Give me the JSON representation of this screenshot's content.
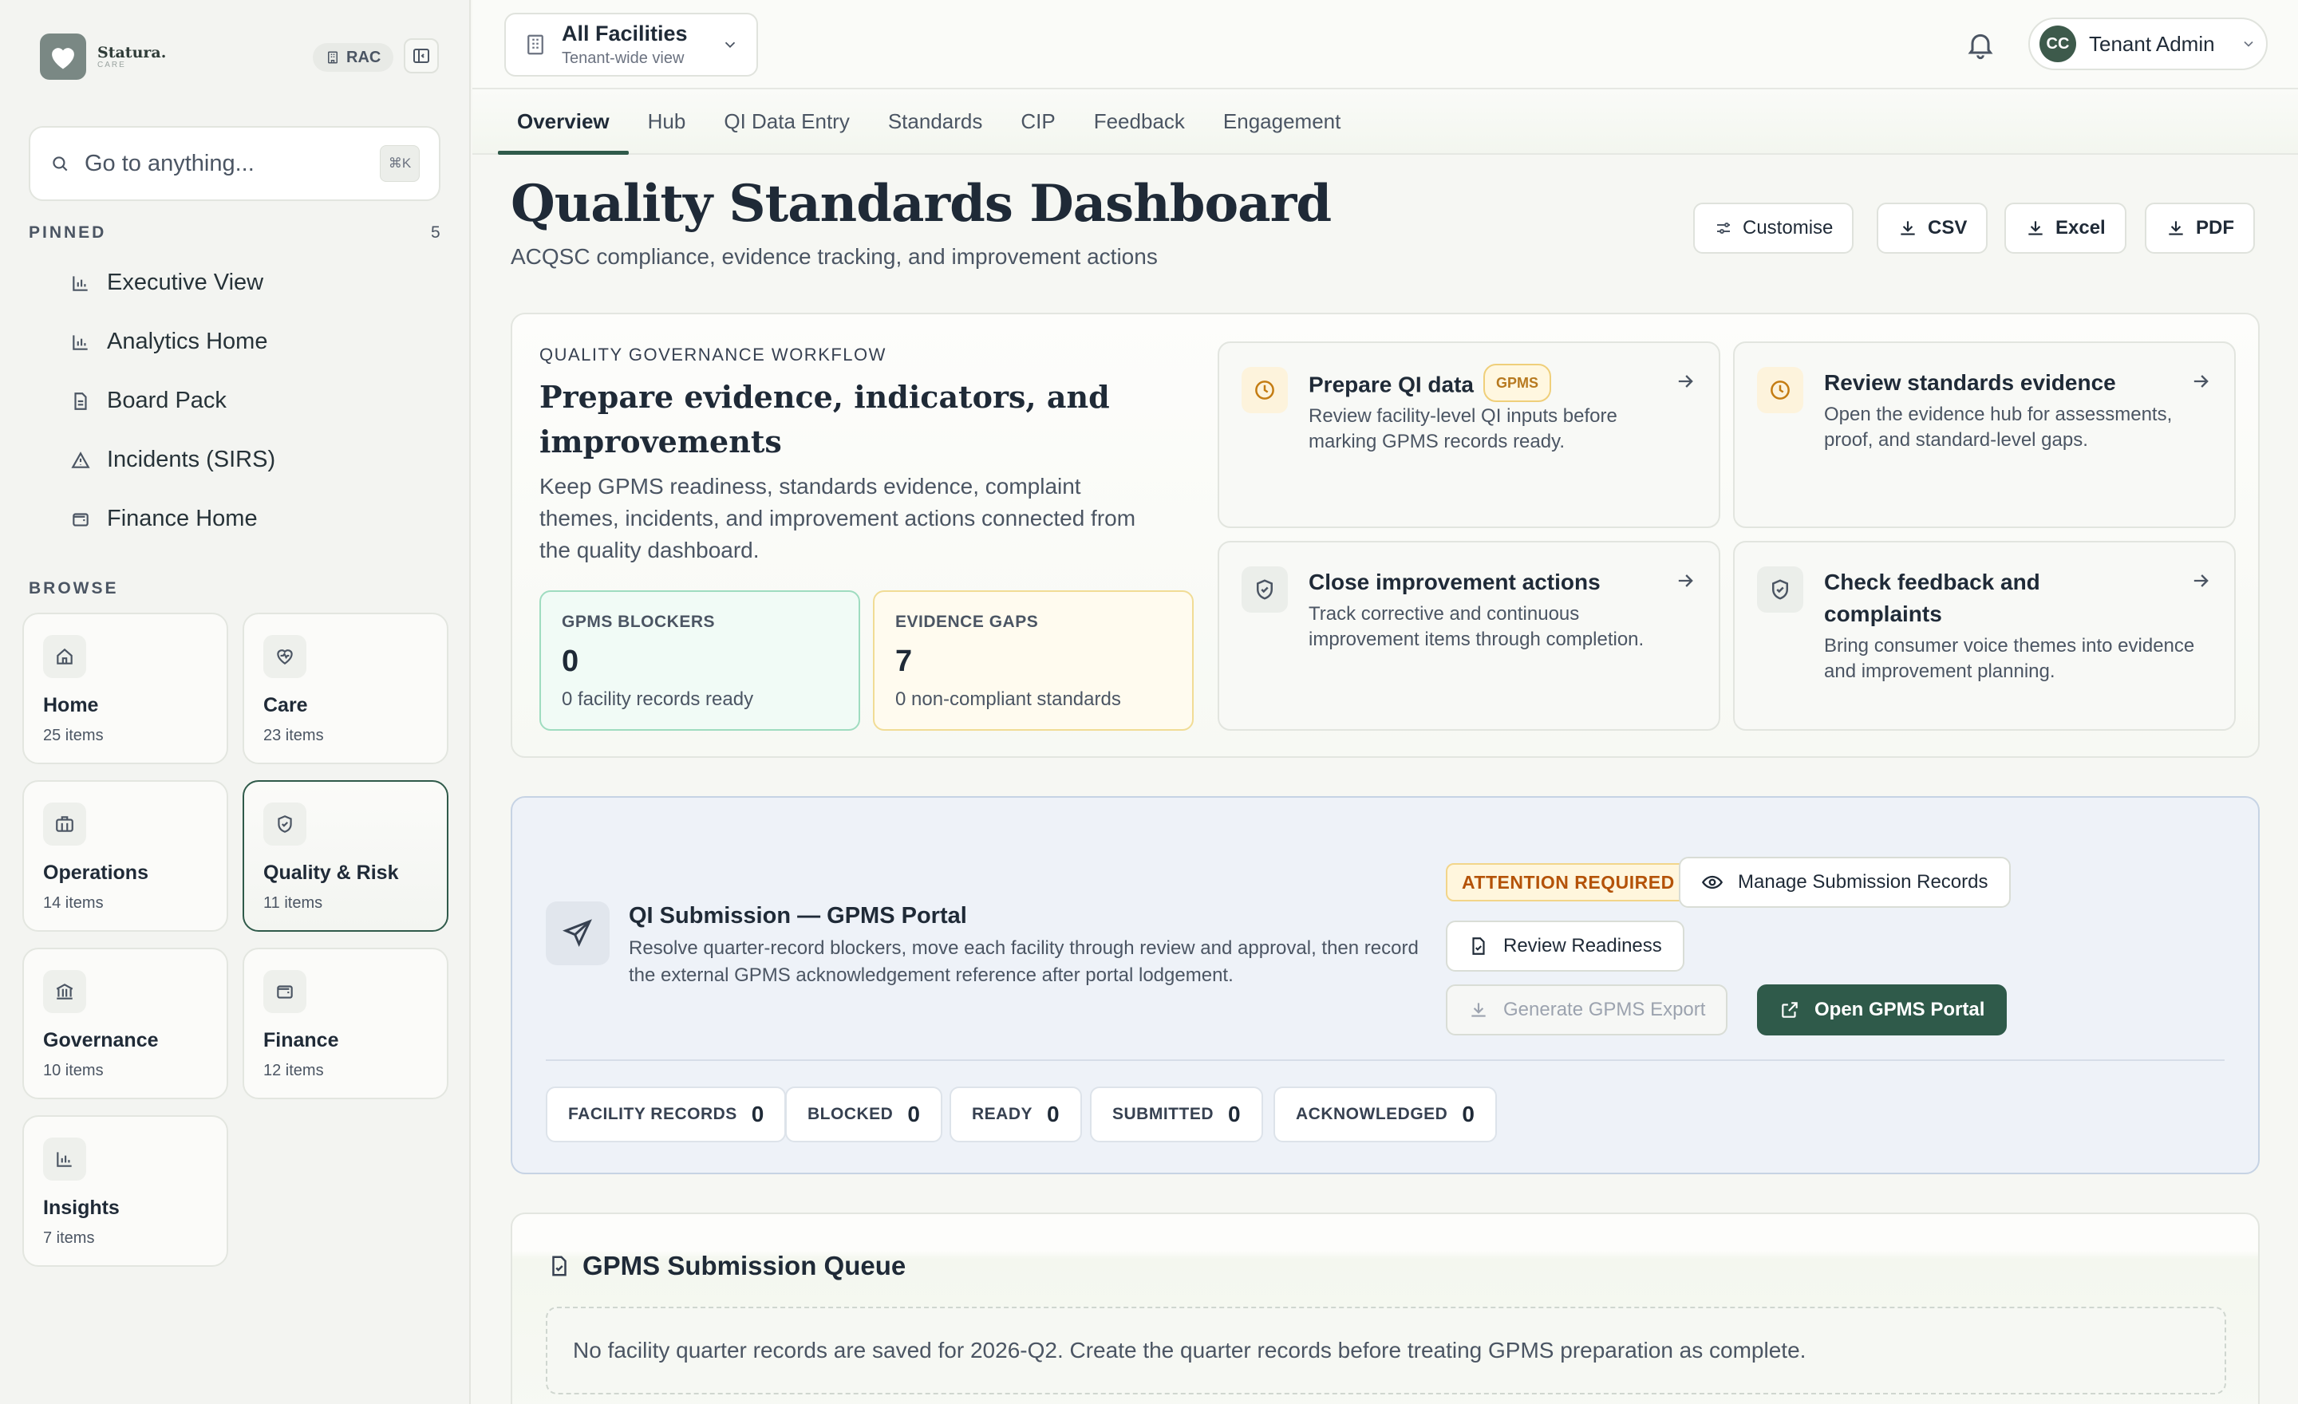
{
  "brand": {
    "name": "Statura.",
    "tagline": "CARE",
    "badge": "RAC"
  },
  "search": {
    "placeholder": "Go to anything...",
    "shortcut": "⌘K"
  },
  "pinned": {
    "label": "PINNED",
    "count": "5",
    "items": [
      {
        "label": "Executive View",
        "icon": "bar-chart-icon"
      },
      {
        "label": "Analytics Home",
        "icon": "bar-chart-icon"
      },
      {
        "label": "Board Pack",
        "icon": "document-icon"
      },
      {
        "label": "Incidents (SIRS)",
        "icon": "warning-triangle-icon"
      },
      {
        "label": "Finance Home",
        "icon": "wallet-icon"
      }
    ]
  },
  "browse": {
    "label": "BROWSE",
    "tiles": [
      {
        "name": "Home",
        "count": "25 items",
        "icon": "home-icon"
      },
      {
        "name": "Care",
        "count": "23 items",
        "icon": "heart-pulse-icon"
      },
      {
        "name": "Operations",
        "count": "14 items",
        "icon": "briefcase-icon"
      },
      {
        "name": "Quality & Risk",
        "count": "11 items",
        "icon": "shield-check-icon",
        "active": true
      },
      {
        "name": "Governance",
        "count": "10 items",
        "icon": "landmark-icon"
      },
      {
        "name": "Finance",
        "count": "12 items",
        "icon": "wallet-icon"
      },
      {
        "name": "Insights",
        "count": "7 items",
        "icon": "bar-chart-icon"
      }
    ]
  },
  "facility": {
    "title": "All Facilities",
    "subtitle": "Tenant-wide view"
  },
  "user": {
    "initials": "CC",
    "name": "Tenant Admin"
  },
  "tabs": [
    "Overview",
    "Hub",
    "QI Data Entry",
    "Standards",
    "CIP",
    "Feedback",
    "Engagement"
  ],
  "active_tab": "Overview",
  "page": {
    "title": "Quality Standards Dashboard",
    "subtitle": "ACQSC compliance, evidence tracking, and improvement actions",
    "actions": {
      "customise": "Customise",
      "csv": "CSV",
      "excel": "Excel",
      "pdf": "PDF"
    }
  },
  "workflow": {
    "kicker": "QUALITY GOVERNANCE WORKFLOW",
    "title": "Prepare evidence, indicators, and improvements",
    "description": "Keep GPMS readiness, standards evidence, complaint themes, incidents, and improvement actions connected from the quality dashboard.",
    "metrics": [
      {
        "label": "GPMS BLOCKERS",
        "value": "0",
        "note": "0 facility records ready"
      },
      {
        "label": "EVIDENCE GAPS",
        "value": "7",
        "note": "0 non-compliant standards"
      }
    ],
    "cards": [
      {
        "title": "Prepare QI data",
        "badge": "GPMS",
        "body": "Review facility-level QI inputs before marking GPMS records ready."
      },
      {
        "title": "Review standards evidence",
        "body": "Open the evidence hub for assessments, proof, and standard-level gaps."
      },
      {
        "title": "Close improvement actions",
        "body": "Track corrective and continuous improvement items through completion."
      },
      {
        "title": "Check feedback and complaints",
        "body": "Bring consumer voice themes into evidence and improvement planning."
      }
    ]
  },
  "qi_submission": {
    "title": "QI Submission — GPMS Portal",
    "description": "Resolve quarter-record blockers, move each facility through review and approval, then record the external GPMS acknowledgement reference after portal lodgement.",
    "status": "ATTENTION REQUIRED",
    "buttons": {
      "manage": "Manage Submission Records",
      "review": "Review Readiness",
      "export": "Generate GPMS Export",
      "portal": "Open GPMS Portal"
    },
    "stats": [
      {
        "label": "FACILITY RECORDS",
        "value": "0"
      },
      {
        "label": "BLOCKED",
        "value": "0"
      },
      {
        "label": "READY",
        "value": "0"
      },
      {
        "label": "SUBMITTED",
        "value": "0"
      },
      {
        "label": "ACKNOWLEDGED",
        "value": "0"
      }
    ]
  },
  "queue": {
    "title": "GPMS Submission Queue",
    "empty_message": "No facility quarter records are saved for 2026-Q2. Create the quarter records before treating GPMS preparation as complete."
  },
  "colors": {
    "accent": "#2f5a4a",
    "attention": "#b45309",
    "gpms_badge": "#b7791f",
    "blocker_border": "#9fdcc0",
    "evidence_border": "#f1dc95"
  }
}
